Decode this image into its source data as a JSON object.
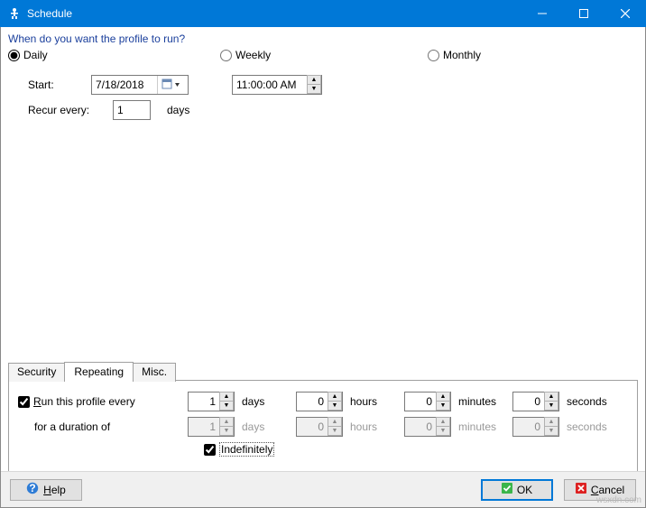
{
  "window": {
    "title": "Schedule"
  },
  "prompt": "When do you want the profile to run?",
  "schedule_radios": {
    "daily": "Daily",
    "weekly": "Weekly",
    "monthly": "Monthly",
    "selected": "daily"
  },
  "start": {
    "label": "Start:",
    "date": "7/18/2018",
    "time": "11:00:00 AM"
  },
  "recur": {
    "label": "Recur every:",
    "value": "1",
    "unit": "days"
  },
  "tabs": {
    "security": "Security",
    "repeating": "Repeating",
    "misc": "Misc.",
    "active": "repeating"
  },
  "repeating": {
    "run_label": "Run this profile every",
    "duration_label": "for a duration of",
    "indef_label": "Indefinitely",
    "units": {
      "days": "days",
      "hours": "hours",
      "minutes": "minutes",
      "seconds": "seconds"
    },
    "run": {
      "days": "1",
      "hours": "0",
      "minutes": "0",
      "seconds": "0"
    },
    "duration": {
      "days": "1",
      "hours": "0",
      "minutes": "0",
      "seconds": "0"
    },
    "run_checked": true,
    "indef_checked": true
  },
  "buttons": {
    "help": "Help",
    "ok": "OK",
    "cancel": "Cancel"
  },
  "watermark": "wsxdn.com"
}
